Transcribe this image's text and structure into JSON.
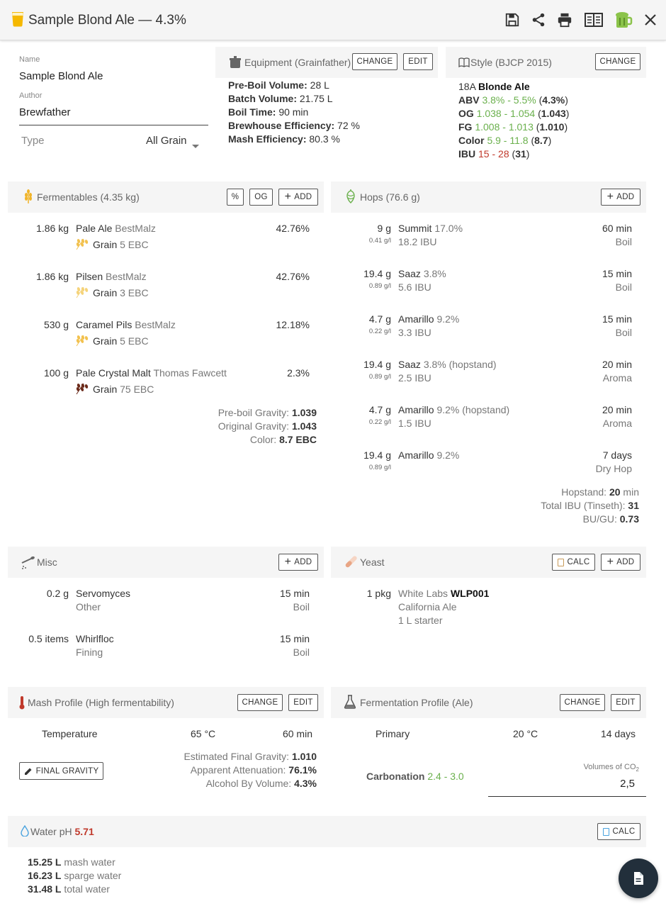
{
  "header": {
    "title": "Sample Blond Ale — 4.3%",
    "accent_color": "#f5b800"
  },
  "details": {
    "name_label": "Name",
    "name_value": "Sample Blond Ale",
    "author_label": "Author",
    "author_value": "Brewfather",
    "type_label": "Type",
    "type_value": "All Grain"
  },
  "equipment": {
    "title": "Equipment (Grainfather)",
    "change": "CHANGE",
    "edit": "EDIT",
    "rows": [
      {
        "label": "Pre-Boil Volume:",
        "value": "28 L"
      },
      {
        "label": "Batch Volume:",
        "value": "21.75 L"
      },
      {
        "label": "Boil Time:",
        "value": "90 min"
      },
      {
        "label": "Brewhouse Efficiency:",
        "value": "72 %"
      },
      {
        "label": "Mash Efficiency:",
        "value": "80.3 %"
      }
    ]
  },
  "style": {
    "title": "Style (BJCP 2015)",
    "change": "CHANGE",
    "code": "18A",
    "name": "Blonde Ale",
    "rows": [
      {
        "label": "ABV",
        "range": "3.8% - 5.5%",
        "value": "4.3%"
      },
      {
        "label": "OG",
        "range": "1.038 - 1.054",
        "value": "1.043"
      },
      {
        "label": "FG",
        "range": "1.008 - 1.013",
        "value": "1.010"
      },
      {
        "label": "Color",
        "range": "5.9 - 11.8",
        "value": "8.7"
      },
      {
        "label": "IBU",
        "range_lo": "15",
        "range_sep": " - ",
        "range_hi": "28",
        "value": "31"
      }
    ]
  },
  "fermentables": {
    "title": "Fermentables (4.35 kg)",
    "pct": "%",
    "og": "OG",
    "add": "ADD",
    "items": [
      {
        "amount": "1.86 kg",
        "name": "Pale Ale",
        "supplier": "BestMalz",
        "type": "Grain",
        "color": "5 EBC",
        "pct": "42.76%"
      },
      {
        "amount": "1.86 kg",
        "name": "Pilsen",
        "supplier": "BestMalz",
        "type": "Grain",
        "color": "3 EBC",
        "pct": "42.76%"
      },
      {
        "amount": "530 g",
        "name": "Caramel Pils",
        "supplier": "BestMalz",
        "type": "Grain",
        "color": "5 EBC",
        "pct": "12.18%"
      },
      {
        "amount": "100 g",
        "name": "Pale Crystal Malt",
        "supplier": "Thomas Fawcett",
        "type": "Grain",
        "color": "75 EBC",
        "pct": "2.3%"
      }
    ],
    "summary": [
      {
        "label": "Pre-boil Gravity:",
        "value": "1.039"
      },
      {
        "label": "Original Gravity:",
        "value": "1.043"
      },
      {
        "label": "Color:",
        "value": "8.7 EBC"
      }
    ]
  },
  "hops": {
    "title": "Hops (76.6 g)",
    "add": "ADD",
    "items": [
      {
        "amount": "9 g",
        "per_l": "0.41 g/l",
        "name": "Summit",
        "alpha": "17.0%",
        "ibu": "18.2 IBU",
        "time": "60 min",
        "use": "Boil"
      },
      {
        "amount": "19.4 g",
        "per_l": "0.89 g/l",
        "name": "Saaz",
        "alpha": "3.8%",
        "ibu": "5.6 IBU",
        "time": "15 min",
        "use": "Boil"
      },
      {
        "amount": "4.7 g",
        "per_l": "0.22 g/l",
        "name": "Amarillo",
        "alpha": "9.2%",
        "ibu": "3.3 IBU",
        "time": "15 min",
        "use": "Boil"
      },
      {
        "amount": "19.4 g",
        "per_l": "0.89 g/l",
        "name": "Saaz",
        "alpha": "3.8% (hopstand)",
        "ibu": "2.5 IBU",
        "time": "20 min",
        "use": "Aroma"
      },
      {
        "amount": "4.7 g",
        "per_l": "0.22 g/l",
        "name": "Amarillo",
        "alpha": "9.2% (hopstand)",
        "ibu": "1.5 IBU",
        "time": "20 min",
        "use": "Aroma"
      },
      {
        "amount": "19.4 g",
        "per_l": "0.89 g/l",
        "name": "Amarillo",
        "alpha": "9.2%",
        "ibu": "",
        "time": "7 days",
        "use": "Dry Hop"
      }
    ],
    "summary": [
      {
        "label": "Hopstand:",
        "value": "20",
        "suffix": " min"
      },
      {
        "label": "Total IBU (Tinseth):",
        "value": "31",
        "suffix": ""
      },
      {
        "label": "BU/GU:",
        "value": "0.73",
        "suffix": ""
      }
    ]
  },
  "misc": {
    "title": "Misc",
    "add": "ADD",
    "items": [
      {
        "amount": "0.2 g",
        "name": "Servomyces",
        "type": "Other",
        "time": "15 min",
        "use": "Boil"
      },
      {
        "amount": "0.5 items",
        "name": "Whirlfloc",
        "type": "Fining",
        "time": "15 min",
        "use": "Boil"
      }
    ]
  },
  "yeast": {
    "title": "Yeast",
    "calc": "CALC",
    "add": "ADD",
    "amount": "1 pkg",
    "lab": "White Labs",
    "code": "WLP001",
    "name": "California Ale",
    "starter": "1 L starter"
  },
  "mash": {
    "title": "Mash Profile (High fermentability)",
    "change": "CHANGE",
    "edit": "EDIT",
    "step_name": "Temperature",
    "step_temp": "65 °C",
    "step_time": "60 min",
    "final_gravity_btn": "FINAL GRAVITY",
    "summary": [
      {
        "label": "Estimated Final Gravity:",
        "value": "1.010"
      },
      {
        "label": "Apparent Attenuation:",
        "value": "76.1%"
      },
      {
        "label": "Alcohol By Volume:",
        "value": "4.3%"
      }
    ]
  },
  "fermentation": {
    "title": "Fermentation Profile (Ale)",
    "change": "CHANGE",
    "edit": "EDIT",
    "step_name": "Primary",
    "step_temp": "20 °C",
    "step_time": "14 days",
    "carbonation_label": "Carbonation",
    "carbonation_range": "2.4 - 3.0",
    "co2_label": "Volumes of CO",
    "co2_sub": "2",
    "co2_value": "2,5"
  },
  "water": {
    "title": "Water pH",
    "ph": "5.71",
    "calc": "CALC",
    "rows": [
      {
        "value": "15.25 L",
        "label": "mash water"
      },
      {
        "value": "16.23 L",
        "label": "sparge water"
      },
      {
        "value": "31.48 L",
        "label": "total water"
      }
    ]
  }
}
